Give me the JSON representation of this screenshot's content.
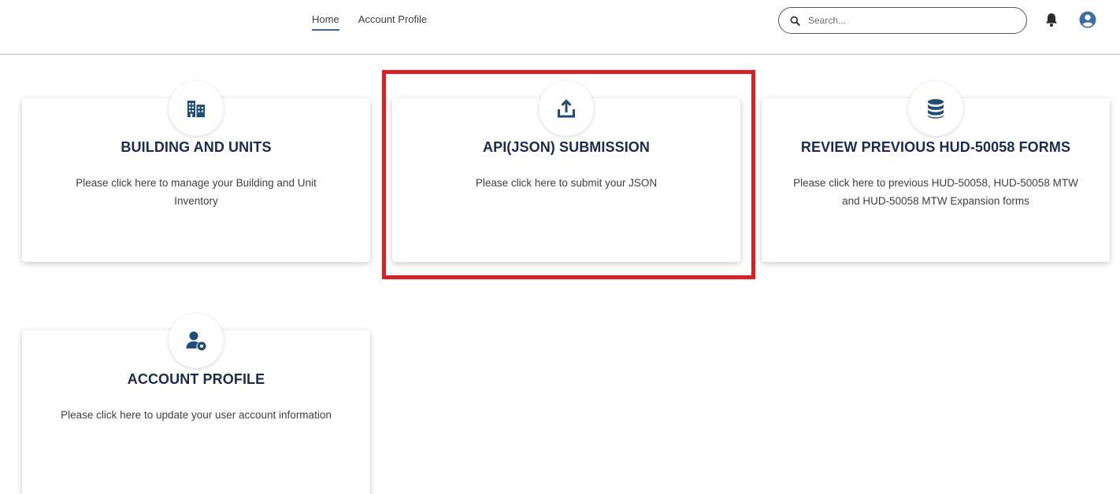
{
  "nav": {
    "items": [
      {
        "label": "Home",
        "active": true
      },
      {
        "label": "Account Profile",
        "active": false
      }
    ]
  },
  "search": {
    "placeholder": "Search...",
    "value": ""
  },
  "icons": {
    "search": "search-icon",
    "notifications": "bell-icon",
    "user": "user-avatar-icon"
  },
  "cards": [
    {
      "title": "BUILDING AND UNITS",
      "description": "Please click here to manage your Building and Unit Inventory",
      "icon": "building-icon"
    },
    {
      "title": "API(JSON) SUBMISSION",
      "description": "Please click here to submit your JSON",
      "icon": "upload-icon",
      "highlighted": true
    },
    {
      "title": "REVIEW PREVIOUS HUD-50058 FORMS",
      "description": "Please click here to previous HUD-50058, HUD-50058 MTW and HUD-50058 MTW Expansion forms",
      "icon": "database-icon"
    },
    {
      "title": "ACCOUNT PROFILE",
      "description": "Please click here to update your user account information",
      "icon": "user-settings-icon"
    }
  ],
  "colors": {
    "accent": "#3b5fc2",
    "icon": "#1f4e79",
    "title": "#1b2a4e",
    "highlight": "#e31c23"
  }
}
